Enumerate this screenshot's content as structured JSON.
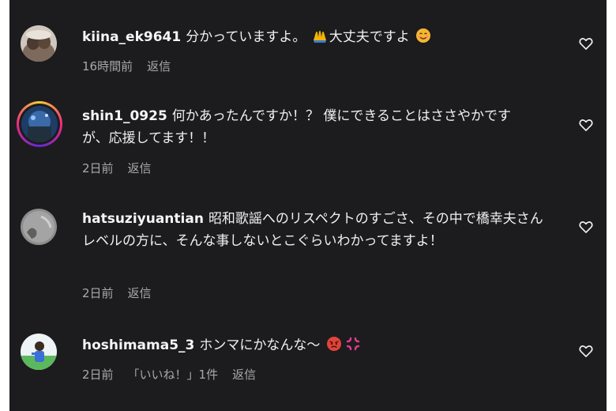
{
  "comments": [
    {
      "username": "kiina_ek9641",
      "text_before": "分かっていますよ。",
      "text_after": "大丈夫ですよ",
      "emoji_1": "raised-hands-emoji",
      "emoji_2": "smiling-face-emoji",
      "time": "16時間前",
      "reply": "返信"
    },
    {
      "username": "shin1_0925",
      "text": "何かあったんですか！？ 僕にできることはささやかですが、応援してます！！",
      "time": "2日前",
      "reply": "返信"
    },
    {
      "username": "hatsuziyuantian",
      "text": "昭和歌謡へのリスペクトのすごさ、その中で橋幸夫さんレベルの方に、そんな事しないとこぐらいわかってますよ！",
      "time": "2日前",
      "reply": "返信"
    },
    {
      "username": "hoshimama5_3",
      "text": "ホンマにかなんな〜",
      "emoji_1": "angry-face-emoji",
      "emoji_2": "anger-symbol-emoji",
      "time": "2日前",
      "likes": "「いいね！」1件",
      "reply": "返信"
    }
  ],
  "colors": {
    "background": "#1c1c1e",
    "text": "#f0f0f0",
    "meta": "#a8a8a8"
  },
  "icons": [
    "heart-outline-icon"
  ]
}
